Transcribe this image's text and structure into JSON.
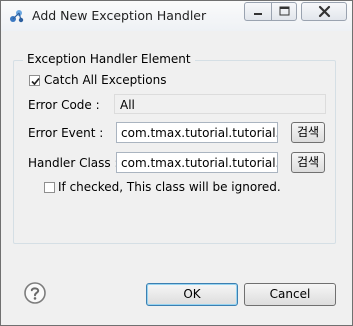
{
  "window": {
    "title": "Add New Exception Handler"
  },
  "group": {
    "title": "Exception Handler Element"
  },
  "catch_all": {
    "label": "Catch All Exceptions",
    "checked": true
  },
  "error_code": {
    "label": "Error Code :",
    "value": "All"
  },
  "error_event": {
    "label": "Error Event :",
    "value": "com.tmax.tutorial.tutorial.Erro",
    "browse_label": "검색"
  },
  "handler_class": {
    "label": "Handler Class :",
    "value": "com.tmax.tutorial.tutorial.Han",
    "browse_label": "검색"
  },
  "ignore_class": {
    "label": "If checked, This class will be ignored.",
    "checked": false
  },
  "buttons": {
    "ok": "OK",
    "cancel": "Cancel"
  },
  "icons": {
    "app": "app-icon",
    "minimize": "minimize-icon",
    "maximize": "maximize-icon",
    "close": "close-icon",
    "help": "help-icon",
    "check": "check-icon"
  },
  "colors": {
    "dialog_bg": "#f0f0f0",
    "close_glyph": "#333333",
    "ok_border": "#3c7fb1"
  }
}
